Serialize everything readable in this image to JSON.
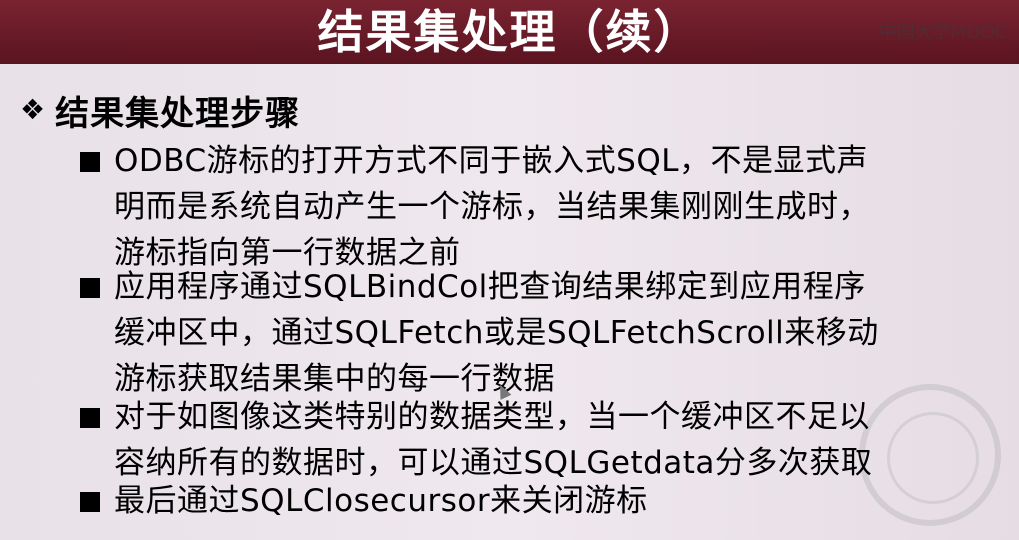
{
  "slide": {
    "title": "结果集处理（续）",
    "watermark": "中国大学MOOC",
    "heading": "结果集处理步骤",
    "items": [
      {
        "line1": "ODBC游标的打开方式不同于嵌入式SQL，不是显式声",
        "line2": "明而是系统自动产生一个游标，当结果集刚刚生成时，",
        "line3": "游标指向第一行数据之前"
      },
      {
        "line1": "应用程序通过SQLBindCol把查询结果绑定到应用程序",
        "line2": "缓冲区中，通过SQLFetch或是SQLFetchScroll来移动",
        "line3": "游标获取结果集中的每一行数据"
      },
      {
        "line1": "对于如图像这类特别的数据类型，当一个缓冲区不足以",
        "line2": "容纳所有的数据时，可以通过SQLGetdata分多次获取"
      },
      {
        "line1": "最后通过SQLClosecursor来关闭游标"
      }
    ]
  },
  "icons": {
    "heading_bullet": "diamond-four-petal-icon",
    "item_bullet": "square-bullet-icon",
    "seal": "university-seal-logo"
  },
  "colors": {
    "title_bar": "#6a1b28",
    "background": "#e7dfe6",
    "text": "#000000"
  }
}
